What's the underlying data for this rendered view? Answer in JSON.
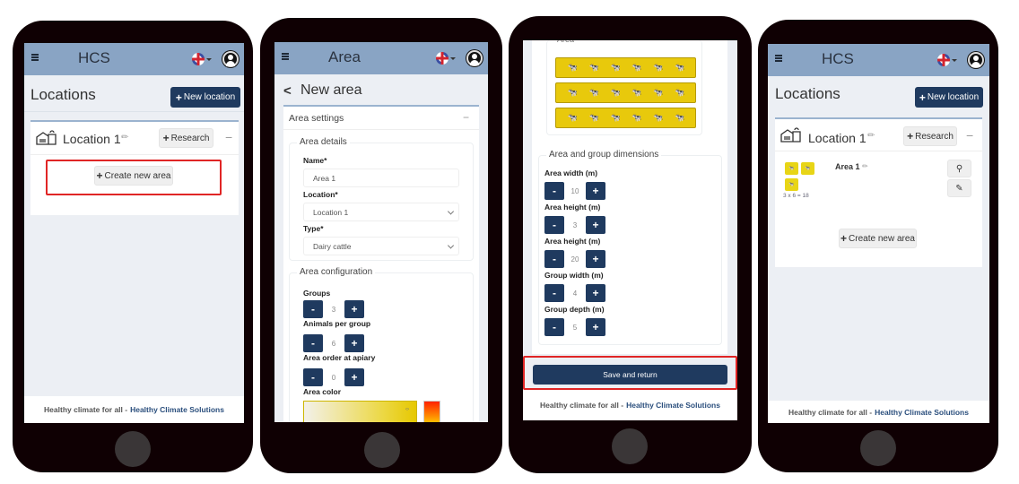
{
  "common": {
    "footer_text": "Healthy climate for all -",
    "footer_link": "Healthy Climate Solutions"
  },
  "screen1": {
    "appbar_title": "HCS",
    "page_title": "Locations",
    "new_location_label": "New location",
    "location_name": "Location 1",
    "research_label": "Research",
    "collapse_symbol": "−",
    "create_area_label": "Create new area"
  },
  "screen2": {
    "appbar_title": "Area",
    "back_symbol": "<",
    "page_title": "New area",
    "section_title": "Area settings",
    "collapse_symbol": "−",
    "details_legend": "Area details",
    "name_label": "Name*",
    "name_value": "Area 1",
    "location_label": "Location*",
    "location_value": "Location 1",
    "type_label": "Type*",
    "type_value": "Dairy cattle",
    "config_legend": "Area configuration",
    "groups_label": "Groups",
    "groups_value": "3",
    "animals_label": "Animals per group",
    "animals_value": "6",
    "order_label": "Area order at apiary",
    "order_value": "0",
    "color_label": "Area color",
    "color_hex": "#e6c800",
    "minus": "-",
    "plus": "+"
  },
  "screen3": {
    "area_legend": "Area",
    "groups": 3,
    "animals_per_group": 6,
    "dimensions_legend": "Area and group dimensions",
    "fields": [
      {
        "label": "Area width (m)",
        "value": "10"
      },
      {
        "label": "Area height (m)",
        "value": "3"
      },
      {
        "label": "Area height (m)",
        "value": "20"
      },
      {
        "label": "Group width (m)",
        "value": "4"
      },
      {
        "label": "Group depth (m)",
        "value": "5"
      }
    ],
    "minus": "-",
    "plus": "+",
    "save_label": "Save and return"
  },
  "screen4": {
    "appbar_title": "HCS",
    "page_title": "Locations",
    "new_location_label": "New location",
    "location_name": "Location 1",
    "research_label": "Research",
    "collapse_symbol": "−",
    "area_name": "Area 1",
    "area_formula": "3 x 6 = 18",
    "create_area_label": "Create new area"
  },
  "icons": {
    "cow": "🐄",
    "search": "⚲",
    "edit": "✎",
    "pencil": "✏"
  }
}
